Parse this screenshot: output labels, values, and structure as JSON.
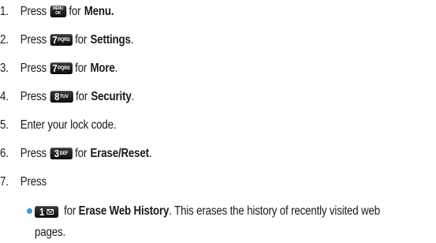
{
  "steps": [
    {
      "num": "1.",
      "pre": "Press",
      "key": {
        "line1": "MENU",
        "line2": "OK"
      },
      "post": "for",
      "bold": "Menu.",
      "tail": ""
    },
    {
      "num": "2.",
      "pre": "Press",
      "key": {
        "big": "7",
        "small": "PQRS"
      },
      "post": "for",
      "bold": "Settings",
      "tail": "."
    },
    {
      "num": "3.",
      "pre": "Press",
      "key": {
        "big": "7",
        "small": "PQRS"
      },
      "post": "for",
      "bold": "More",
      "tail": "."
    },
    {
      "num": "4.",
      "pre": "Press",
      "key": {
        "big": "8",
        "small": "TUV"
      },
      "post": "for",
      "bold": "Security",
      "tail": "."
    },
    {
      "num": "5.",
      "text": "Enter your lock code."
    },
    {
      "num": "6.",
      "pre": "Press",
      "key": {
        "big": "3",
        "small": "DEF"
      },
      "post": "for",
      "bold": "Erase/Reset",
      "tail": "."
    },
    {
      "num": "7.",
      "text": "Press"
    }
  ],
  "sub_items": [
    {
      "key": {
        "big": "1",
        "icon": "envelope-icon"
      },
      "post": "for",
      "bold": "Erase Web History",
      "tail": ". This erases the history of recently visited web pages."
    }
  ],
  "colors": {
    "bullet": "#3aa0d8",
    "key_bg": "#111111",
    "text": "#1a1a1a"
  }
}
